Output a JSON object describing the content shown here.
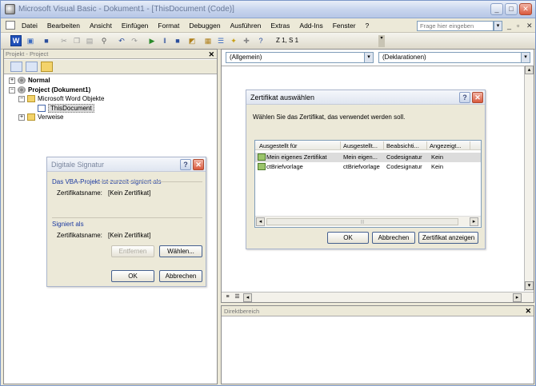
{
  "window": {
    "title": "Microsoft Visual Basic - Dokument1 - [ThisDocument (Code)]",
    "minimize_glyph": "_",
    "restore_glyph": "□",
    "close_glyph": "✕"
  },
  "menubar": {
    "items": [
      "Datei",
      "Bearbeiten",
      "Ansicht",
      "Einfügen",
      "Format",
      "Debuggen",
      "Ausführen",
      "Extras",
      "Add-Ins",
      "Fenster",
      "?"
    ],
    "help_placeholder": "Frage hier eingeben",
    "mdi_min": "_",
    "mdi_restore": "▫",
    "mdi_close": "✕"
  },
  "toolbar": {
    "word_label": "W",
    "position": "Z 1, S 1"
  },
  "project_panel": {
    "title": "Projekt - Project",
    "close": "✕",
    "tree": [
      {
        "label": "Normal",
        "bold": true
      },
      {
        "label": "Project (Dokument1)",
        "bold": true
      },
      {
        "label": "Microsoft Word Objekte",
        "bold": false
      },
      {
        "label": "ThisDocument",
        "bold": false
      },
      {
        "label": "Verweise",
        "bold": false
      }
    ]
  },
  "code_window": {
    "object_combo": "(Allgemein)",
    "proc_combo": "(Deklarationen)"
  },
  "direct": {
    "title": "Direktbereich",
    "close": "✕"
  },
  "sig_dialog": {
    "title": "Digitale Signatur",
    "help": "?",
    "close": "✕",
    "status": "Das VBA-Projekt ist zurzeit signiert als",
    "cert_label_1": "Zertifikatsname:",
    "cert_value_1": "[Kein Zertifikat]",
    "signed_as": "Signiert als",
    "cert_label_2": "Zertifikatsname:",
    "cert_value_2": "[Kein Zertifikat]",
    "remove": "Entfernen",
    "choose": "Wählen...",
    "ok": "OK",
    "cancel": "Abbrechen"
  },
  "cert_dialog": {
    "title": "Zertifikat auswählen",
    "help": "?",
    "close": "✕",
    "instruction": "Wählen Sie das Zertifikat, das verwendet werden soll.",
    "columns": [
      "Ausgestellt für",
      "Ausgestellt...",
      "Beabsichti...",
      "Angezeigt..."
    ],
    "rows": [
      [
        "Mein eigenes Zertifikat",
        "Mein eigen...",
        "Codesignatur",
        "Kein"
      ],
      [
        "ctBriefvorlage",
        "ctBriefvorlage",
        "Codesignatur",
        "Kein"
      ]
    ],
    "ok": "OK",
    "cancel": "Abbrechen",
    "show": "Zertifikat anzeigen"
  }
}
